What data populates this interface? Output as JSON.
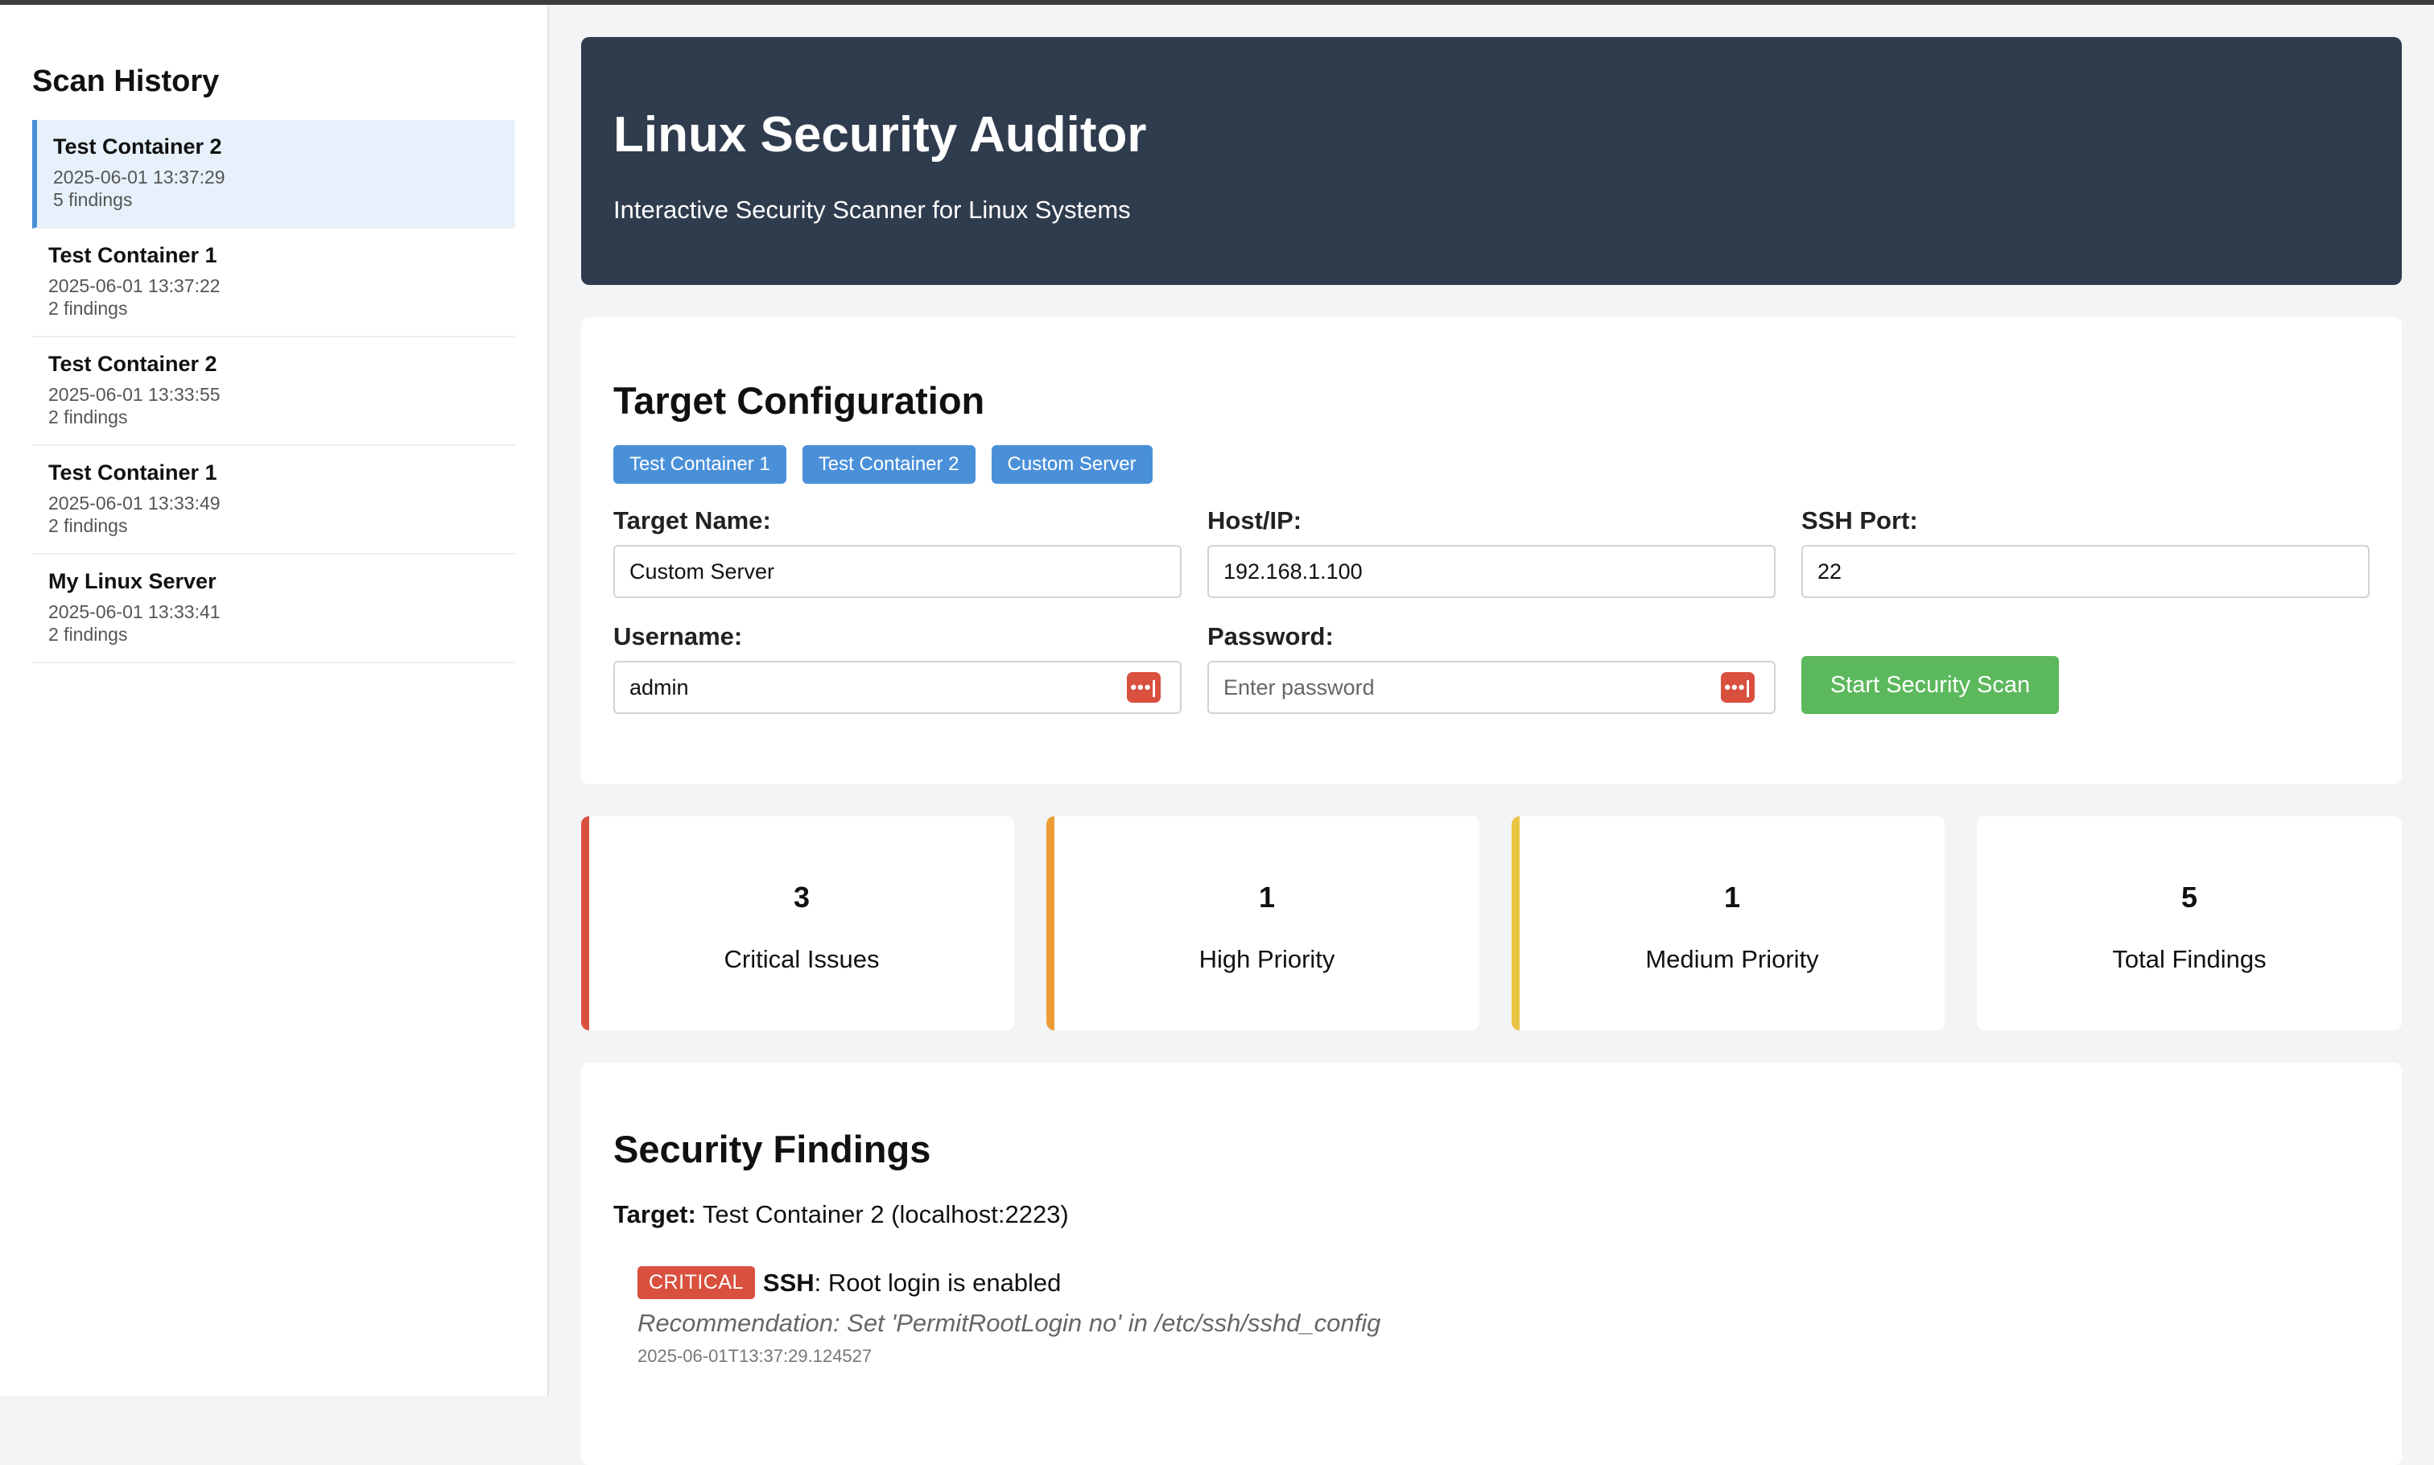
{
  "sidebar": {
    "title": "Scan History",
    "items": [
      {
        "name": "Test Container 2",
        "date": "2025-06-01 13:37:29",
        "count": "5 findings",
        "active": true
      },
      {
        "name": "Test Container 1",
        "date": "2025-06-01 13:37:22",
        "count": "2 findings"
      },
      {
        "name": "Test Container 2",
        "date": "2025-06-01 13:33:55",
        "count": "2 findings"
      },
      {
        "name": "Test Container 1",
        "date": "2025-06-01 13:33:49",
        "count": "2 findings"
      },
      {
        "name": "My Linux Server",
        "date": "2025-06-01 13:33:41",
        "count": "2 findings"
      }
    ]
  },
  "header": {
    "title": "Linux Security Auditor",
    "subtitle": "Interactive Security Scanner for Linux Systems"
  },
  "config": {
    "title": "Target Configuration",
    "presets": [
      "Test Container 1",
      "Test Container 2",
      "Custom Server"
    ],
    "target_name_label": "Target Name:",
    "target_name_value": "Custom Server",
    "host_label": "Host/IP:",
    "host_value": "192.168.1.100",
    "port_label": "SSH Port:",
    "port_value": "22",
    "username_label": "Username:",
    "username_value": "admin",
    "password_label": "Password:",
    "password_placeholder": "Enter password",
    "scan_button": "Start Security Scan",
    "key_icon": "password-manager-icon"
  },
  "stats": {
    "critical": {
      "num": "3",
      "label": "Critical Issues",
      "color": "#d9503f"
    },
    "high": {
      "num": "1",
      "label": "High Priority",
      "color": "#ed9d38"
    },
    "medium": {
      "num": "1",
      "label": "Medium Priority",
      "color": "#eac443"
    },
    "total": {
      "num": "5",
      "label": "Total Findings"
    }
  },
  "findings": {
    "title": "Security Findings",
    "target_label": "Target:",
    "target_value": "Test Container 2 (localhost:2223)",
    "items": [
      {
        "severity": "CRITICAL",
        "category": "SSH",
        "message": ": Root login is enabled",
        "recommendation": "Recommendation: Set 'PermitRootLogin no' in /etc/ssh/sshd_config",
        "timestamp": "2025-06-01T13:37:29.124527"
      }
    ]
  },
  "colors": {
    "header_bg": "#2f3c4e",
    "accent": "#4a90d9",
    "success": "#5cb85c"
  }
}
